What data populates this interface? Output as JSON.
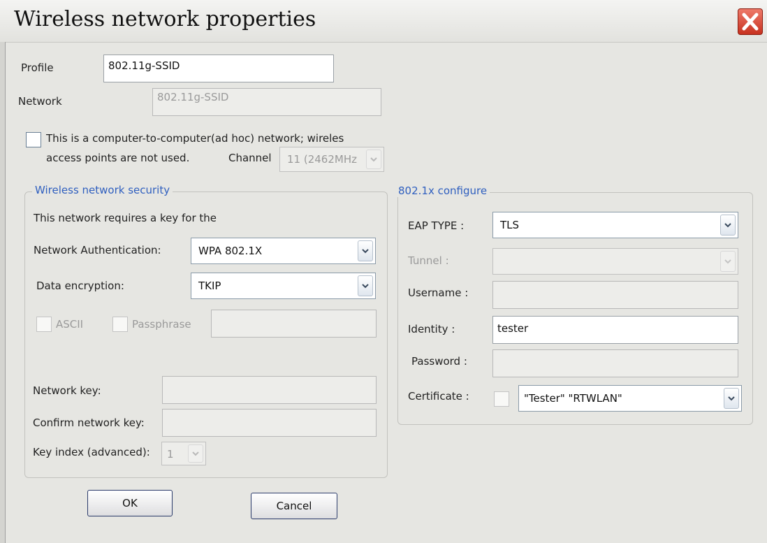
{
  "window": {
    "title": "Wireless network properties"
  },
  "profile": {
    "label": "Profile",
    "value": "802.11g-SSID"
  },
  "network": {
    "label": "Network",
    "value": "802.11g-SSID"
  },
  "adhoc": {
    "line1": "This is a computer-to-computer(ad hoc) network; wireles",
    "line2": "access points are not used.",
    "channel_label": "Channel",
    "channel_value": "11 (2462MHz"
  },
  "security": {
    "legend": "Wireless network security",
    "requires_text": "This network requires a key for the",
    "auth_label": "Network Authentication:",
    "auth_value": "WPA 802.1X",
    "enc_label": "Data encryption:",
    "enc_value": "TKIP",
    "ascii_label": "ASCII",
    "passphrase_label": "Passphrase",
    "network_key_label": "Network key:",
    "confirm_key_label": "Confirm network key:",
    "key_index_label": "Key index (advanced):",
    "key_index_value": "1"
  },
  "dot1x": {
    "legend": "802.1x configure",
    "eap_label": "EAP TYPE :",
    "eap_value": "TLS",
    "tunnel_label": "Tunnel :",
    "username_label": "Username :",
    "identity_label": "Identity :",
    "identity_value": "tester",
    "password_label": "Password :",
    "certificate_label": "Certificate :",
    "certificate_value": "\"Tester\" \"RTWLAN\""
  },
  "buttons": {
    "ok": "OK",
    "cancel": "Cancel"
  },
  "colors": {
    "legend_blue": "#2f5fbf",
    "close_red": "#d9432e",
    "face": "#e6e6e2"
  },
  "icons": {
    "close": "close-icon",
    "dropdown": "chevron-down-icon"
  }
}
